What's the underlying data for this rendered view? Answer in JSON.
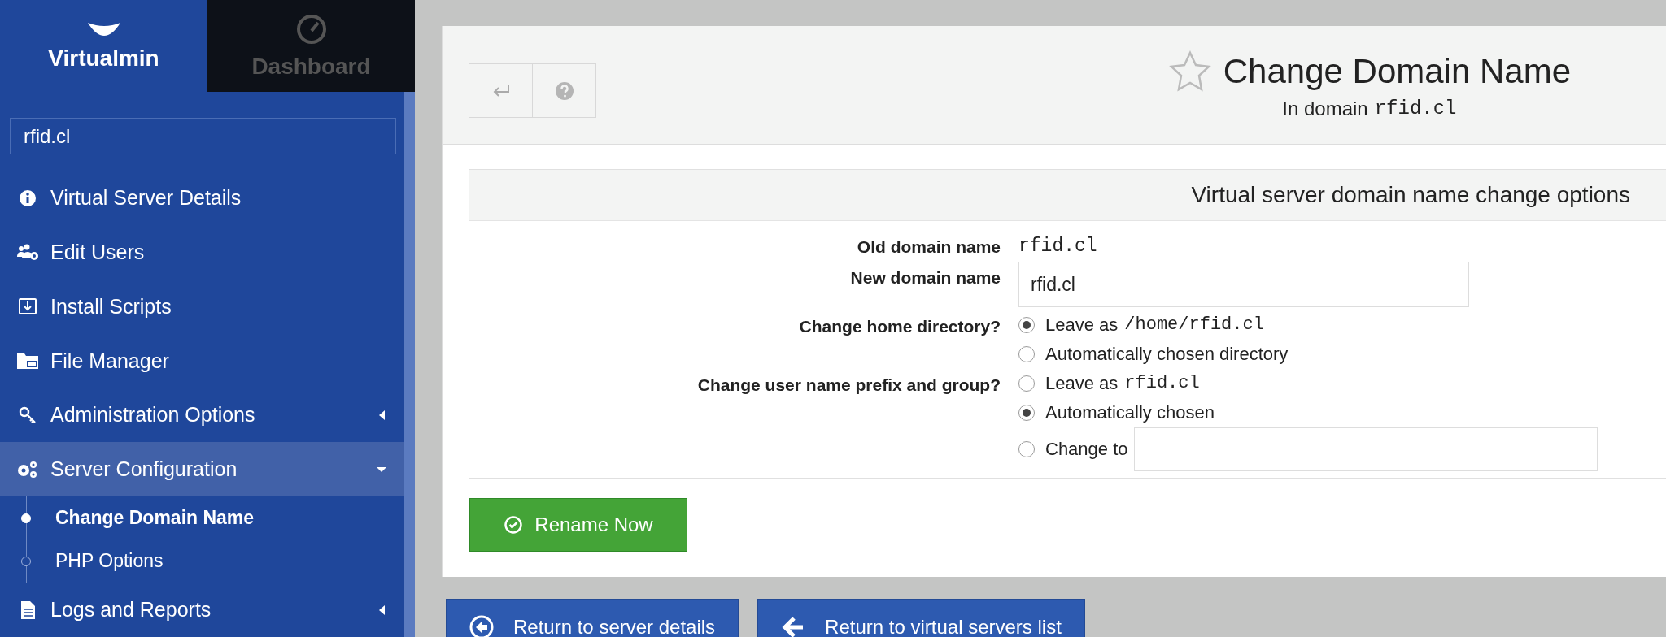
{
  "sidebar": {
    "tabs": [
      {
        "label": "Virtualmin",
        "selected": true
      },
      {
        "label": "Dashboard",
        "selected": false
      }
    ],
    "search": {
      "value": "rfid.cl"
    },
    "items": [
      {
        "label": "Virtual Server Details",
        "kind": "link",
        "selected": false
      },
      {
        "label": "Edit Users",
        "kind": "link",
        "selected": false
      },
      {
        "label": "Install Scripts",
        "kind": "link",
        "selected": false
      },
      {
        "label": "File Manager",
        "kind": "link",
        "selected": false
      },
      {
        "label": "Administration Options",
        "kind": "group",
        "selected": false,
        "expanded": false
      },
      {
        "label": "Server Configuration",
        "kind": "group",
        "selected": true,
        "expanded": true,
        "children": [
          {
            "label": "Change Domain Name",
            "selected": true
          },
          {
            "label": "PHP Options",
            "selected": false
          }
        ]
      },
      {
        "label": "Logs and Reports",
        "kind": "group",
        "selected": false,
        "expanded": false
      }
    ]
  },
  "main": {
    "header": {
      "favorite": false,
      "title": "Change Domain Name",
      "subtitle": {
        "text": "In domain",
        "domain": "rfid.cl"
      }
    },
    "form": {
      "heading": "Virtual server domain name change options",
      "rows": [
        {
          "label": "Old domain name",
          "kind": "text",
          "value": "rfid.cl"
        },
        {
          "label": "New domain name",
          "kind": "input",
          "value": "rfid.cl"
        },
        {
          "label": "Change home directory?",
          "kind": "radio",
          "options": [
            {
              "kind": "plain",
              "label": "Leave as",
              "code": "/home/rfid.cl",
              "selected": true
            },
            {
              "kind": "plain",
              "label": "Automatically chosen directory",
              "selected": false
            }
          ]
        },
        {
          "label": "Change user name prefix and group?",
          "kind": "radio",
          "options": [
            {
              "kind": "plain",
              "label": "Leave as",
              "code": "rfid.cl",
              "selected": false
            },
            {
              "kind": "plain",
              "label": "Automatically chosen",
              "selected": true
            },
            {
              "kind": "input",
              "label": "Change to",
              "selected": false
            }
          ]
        }
      ]
    },
    "submit": "Rename Now"
  },
  "footer_buttons": [
    {
      "label": "Return to server details"
    },
    {
      "label": "Return to virtual servers list"
    }
  ]
}
